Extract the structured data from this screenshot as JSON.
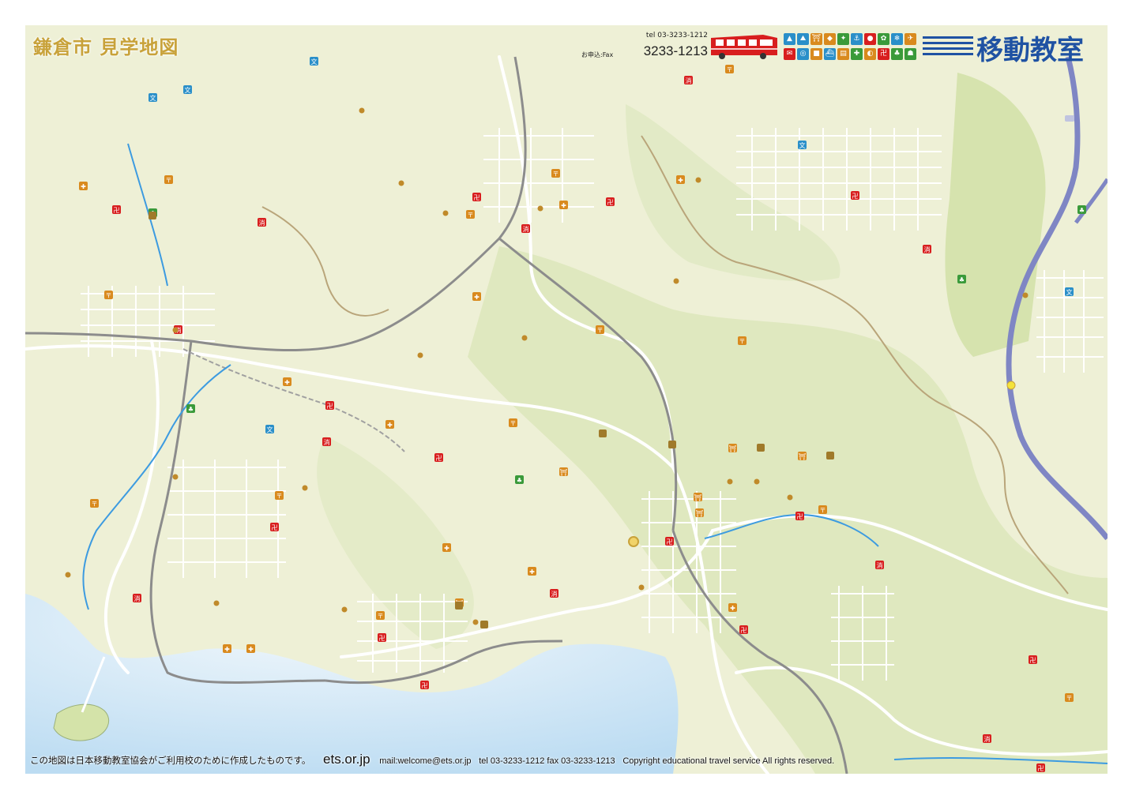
{
  "map": {
    "title": "鎌倉市 見学地図",
    "colors": {
      "land": "#eef0d6",
      "land_green": "#d7e3b1",
      "sea": "#cfe6f6",
      "sea_light": "#e4f1fa",
      "highway": "#7f86c4",
      "rail": "#8c8c8c",
      "river": "#3d9be0",
      "road": "#ffffff",
      "boundary": "#b9a57a"
    },
    "icons": [
      "shrine-icon",
      "temple-icon",
      "fire-station-icon",
      "hospital-icon",
      "post-office-icon",
      "school-icon",
      "police-icon",
      "museum-icon",
      "park-icon"
    ]
  },
  "header": {
    "tel_line": "tel 03-3233-1212",
    "fax_label": "お申込:Fax",
    "fax_number": "3233-1213",
    "brand": "移動教室",
    "brand_color": "#1f52a3",
    "bus_color": "#d81e1e",
    "legend_icons": [
      {
        "name": "mountain-icon",
        "color": "#2a8fc9",
        "glyph": "▲"
      },
      {
        "name": "hiking-icon",
        "color": "#2a8fc9",
        "glyph": "⛰"
      },
      {
        "name": "shrine-icon",
        "color": "#d98a1e",
        "glyph": "⛩"
      },
      {
        "name": "museum-icon",
        "color": "#d98a1e",
        "glyph": "◆"
      },
      {
        "name": "walking-icon",
        "color": "#3a9a3a",
        "glyph": "✦"
      },
      {
        "name": "fishing-icon",
        "color": "#2a8fc9",
        "glyph": "⚓"
      },
      {
        "name": "food-icon",
        "color": "#d81e1e",
        "glyph": "●"
      },
      {
        "name": "flower-icon",
        "color": "#3a9a3a",
        "glyph": "✿"
      },
      {
        "name": "snow-icon",
        "color": "#2a8fc9",
        "glyph": "❄"
      },
      {
        "name": "plane-icon",
        "color": "#d98a1e",
        "glyph": "✈"
      },
      {
        "name": "mail-icon",
        "color": "#d81e1e",
        "glyph": "✉"
      },
      {
        "name": "camera-icon",
        "color": "#2a8fc9",
        "glyph": "◎"
      },
      {
        "name": "bus-icon",
        "color": "#d98a1e",
        "glyph": "■"
      },
      {
        "name": "ship-icon",
        "color": "#2a8fc9",
        "glyph": "⛴"
      },
      {
        "name": "book-icon",
        "color": "#d98a1e",
        "glyph": "▤"
      },
      {
        "name": "farm-icon",
        "color": "#3a9a3a",
        "glyph": "✚"
      },
      {
        "name": "sweets-icon",
        "color": "#d98a1e",
        "glyph": "◐"
      },
      {
        "name": "temple-icon",
        "color": "#d81e1e",
        "glyph": "卍"
      },
      {
        "name": "tree-icon",
        "color": "#3a9a3a",
        "glyph": "♣"
      },
      {
        "name": "lighthouse-icon",
        "color": "#3a9a3a",
        "glyph": "☗"
      }
    ]
  },
  "footer": {
    "note": "この地図は日本移動教室協会がご利用校のために作成したものです。",
    "site": "ets.or.jp",
    "mail": "mail:welcome@ets.or.jp",
    "tel": "tel 03-3233-1212  fax 03-3233-1213",
    "copyright": "Copyright educational travel service All rights reserved."
  }
}
